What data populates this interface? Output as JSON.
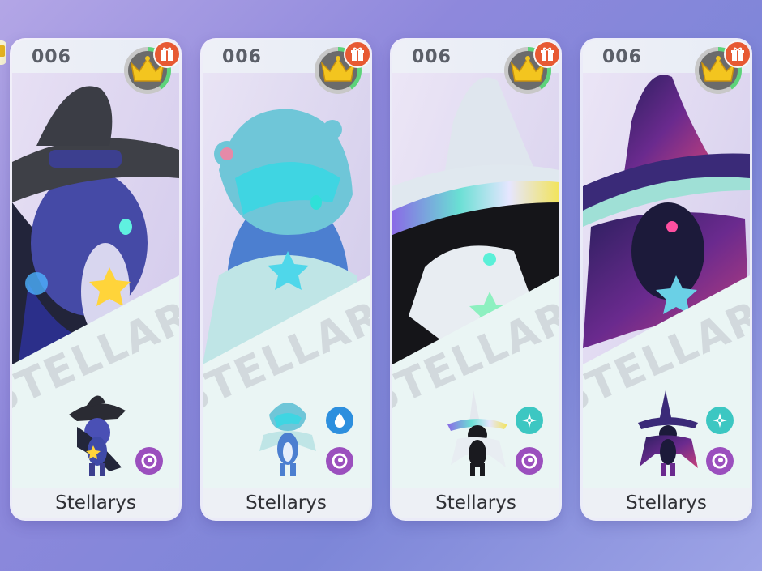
{
  "cards": [
    {
      "dex_number": "006",
      "name": "Stellarys",
      "watermark": "STELLARYS",
      "variant": "witch-navy",
      "type_icons": [
        "psychic-icon"
      ]
    },
    {
      "dex_number": "006",
      "name": "Stellarys",
      "watermark": "STELLARYS",
      "variant": "hood-teal",
      "type_icons": [
        "water-icon",
        "psychic-icon"
      ]
    },
    {
      "dex_number": "006",
      "name": "Stellarys",
      "watermark": "STELLARYS",
      "variant": "witch-iridescent",
      "type_icons": [
        "ice-icon",
        "psychic-icon"
      ]
    },
    {
      "dex_number": "006",
      "name": "Stellarys",
      "watermark": "STELLARYS",
      "variant": "witch-galaxy",
      "type_icons": [
        "ice-icon",
        "psychic-icon"
      ]
    }
  ],
  "colors": {
    "crown": "#f3c51f",
    "gift": "#e75a33",
    "psychic": "#9b4fbe",
    "water": "#2d8fde",
    "ice": "#3cc7c2"
  }
}
